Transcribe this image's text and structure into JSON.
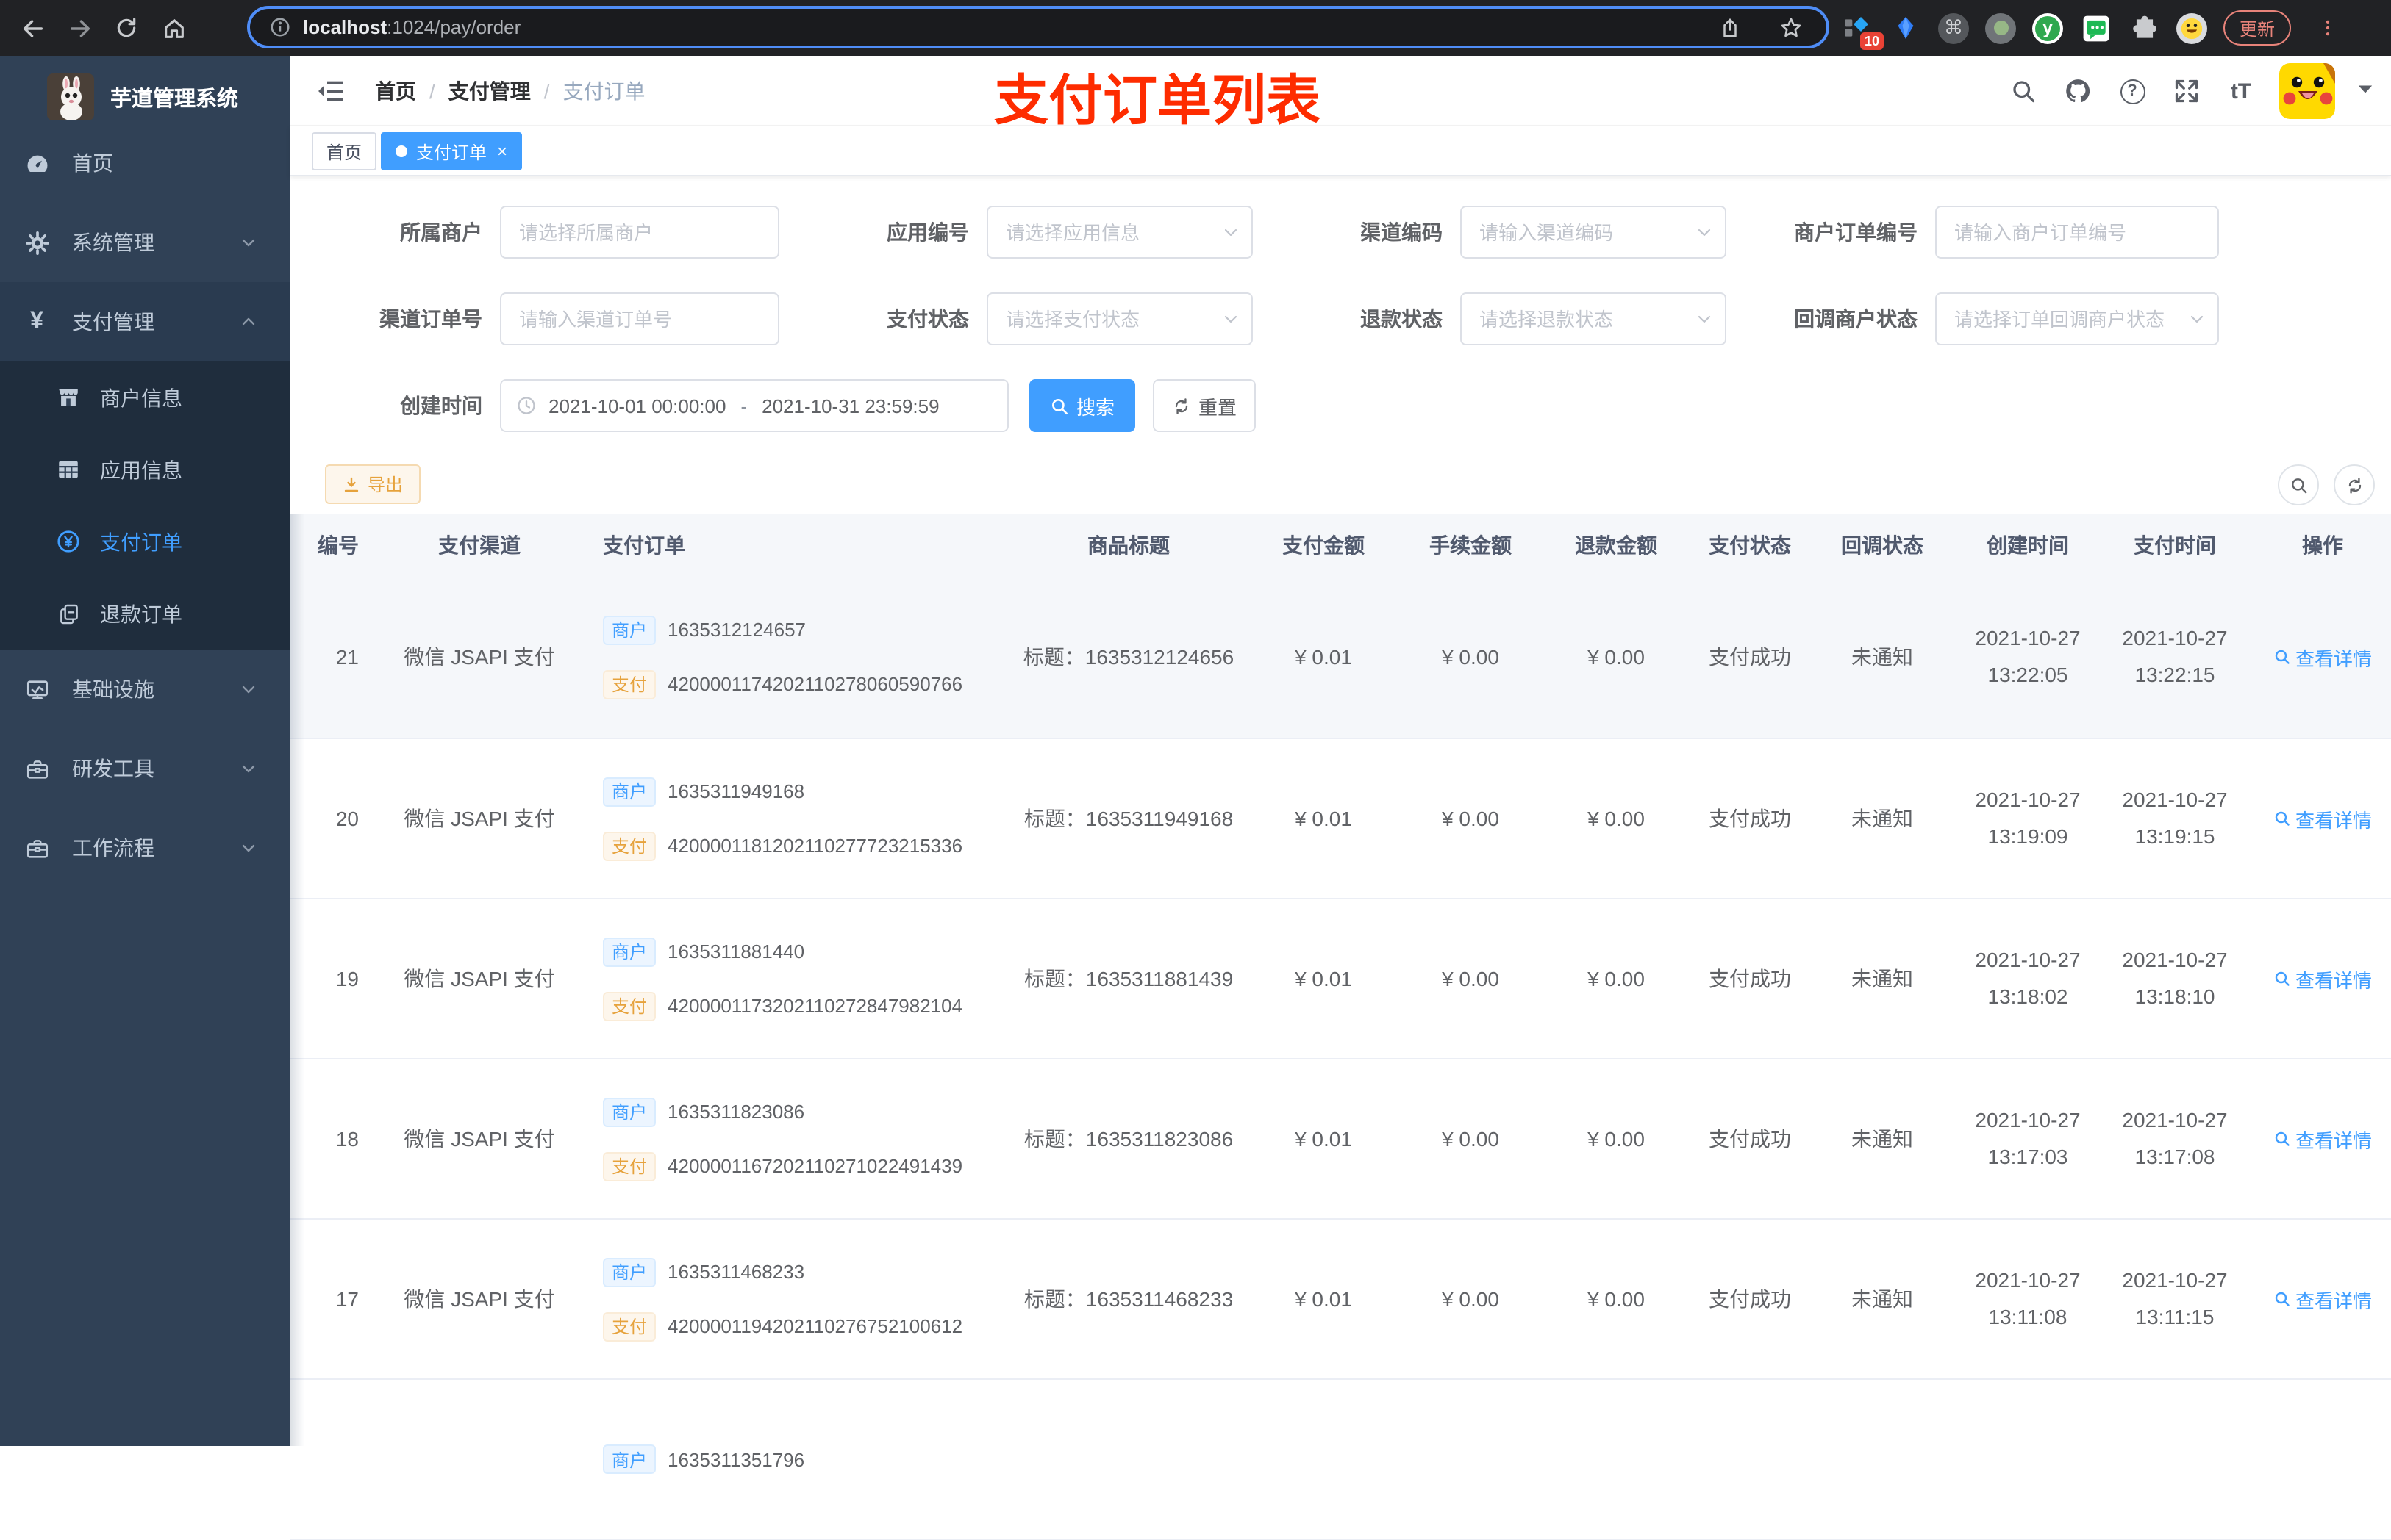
{
  "browser": {
    "url_host": "localhost",
    "url_rest": ":1024/pay/order",
    "ext_badge": "10",
    "ext_cmd": "⌘",
    "ext_y": "y",
    "update_label": "更新"
  },
  "sidebar": {
    "title": "芋道管理系统",
    "menu": [
      {
        "label": "首页"
      },
      {
        "label": "系统管理"
      },
      {
        "label": "支付管理"
      }
    ],
    "submenu": [
      {
        "label": "商户信息"
      },
      {
        "label": "应用信息"
      },
      {
        "label": "支付订单"
      },
      {
        "label": "退款订单"
      }
    ],
    "menu2": [
      {
        "label": "基础设施"
      },
      {
        "label": "研发工具"
      },
      {
        "label": "工作流程"
      }
    ]
  },
  "navbar": {
    "breadcrumb": [
      "首页",
      "支付管理",
      "支付订单"
    ],
    "sep": "/",
    "font_icon_label": "tT"
  },
  "overlay_title": "支付订单列表",
  "tags": {
    "home": "首页",
    "active": "支付订单",
    "close": "×"
  },
  "filters": {
    "f1": {
      "label": "所属商户",
      "placeholder": "请选择所属商户"
    },
    "f2": {
      "label": "应用编号",
      "placeholder": "请选择应用信息"
    },
    "f3": {
      "label": "渠道编码",
      "placeholder": "请输入渠道编码"
    },
    "f4": {
      "label": "商户订单编号",
      "placeholder": "请输入商户订单编号"
    },
    "f5": {
      "label": "渠道订单号",
      "placeholder": "请输入渠道订单号"
    },
    "f6": {
      "label": "支付状态",
      "placeholder": "请选择支付状态"
    },
    "f7": {
      "label": "退款状态",
      "placeholder": "请选择退款状态"
    },
    "f8": {
      "label": "回调商户状态",
      "placeholder": "请选择订单回调商户状态"
    },
    "f9": {
      "label": "创建时间",
      "start": "2021-10-01 00:00:00",
      "sep": "-",
      "end": "2021-10-31 23:59:59"
    }
  },
  "actions": {
    "search": "搜索",
    "reset": "重置",
    "export": "导出"
  },
  "table": {
    "columns": [
      "编号",
      "支付渠道",
      "支付订单",
      "商品标题",
      "支付金额",
      "手续金额",
      "退款金额",
      "支付状态",
      "回调状态",
      "创建时间",
      "支付时间",
      "操作"
    ],
    "tag_merchant": "商户",
    "tag_pay": "支付",
    "rows": [
      {
        "id": "21",
        "channel": "微信 JSAPI 支付",
        "merchant_no": "1635312124657",
        "pay_no": "4200001174202110278060590766",
        "title": "标题：1635312124656",
        "amount": "¥ 0.01",
        "fee": "¥ 0.00",
        "refund": "¥ 0.00",
        "status": "支付成功",
        "notify": "未通知",
        "created_date": "2021-10-27",
        "created_time": "13:22:05",
        "paid_date": "2021-10-27",
        "paid_time": "13:22:15",
        "action": "查看详情"
      },
      {
        "id": "20",
        "channel": "微信 JSAPI 支付",
        "merchant_no": "1635311949168",
        "pay_no": "4200001181202110277723215336",
        "title": "标题：1635311949168",
        "amount": "¥ 0.01",
        "fee": "¥ 0.00",
        "refund": "¥ 0.00",
        "status": "支付成功",
        "notify": "未通知",
        "created_date": "2021-10-27",
        "created_time": "13:19:09",
        "paid_date": "2021-10-27",
        "paid_time": "13:19:15",
        "action": "查看详情"
      },
      {
        "id": "19",
        "channel": "微信 JSAPI 支付",
        "merchant_no": "1635311881440",
        "pay_no": "4200001173202110272847982104",
        "title": "标题：1635311881439",
        "amount": "¥ 0.01",
        "fee": "¥ 0.00",
        "refund": "¥ 0.00",
        "status": "支付成功",
        "notify": "未通知",
        "created_date": "2021-10-27",
        "created_time": "13:18:02",
        "paid_date": "2021-10-27",
        "paid_time": "13:18:10",
        "action": "查看详情"
      },
      {
        "id": "18",
        "channel": "微信 JSAPI 支付",
        "merchant_no": "1635311823086",
        "pay_no": "4200001167202110271022491439",
        "title": "标题：1635311823086",
        "amount": "¥ 0.01",
        "fee": "¥ 0.00",
        "refund": "¥ 0.00",
        "status": "支付成功",
        "notify": "未通知",
        "created_date": "2021-10-27",
        "created_time": "13:17:03",
        "paid_date": "2021-10-27",
        "paid_time": "13:17:08",
        "action": "查看详情"
      },
      {
        "id": "17",
        "channel": "微信 JSAPI 支付",
        "merchant_no": "1635311468233",
        "pay_no": "4200001194202110276752100612",
        "title": "标题：1635311468233",
        "amount": "¥ 0.01",
        "fee": "¥ 0.00",
        "refund": "¥ 0.00",
        "status": "支付成功",
        "notify": "未通知",
        "created_date": "2021-10-27",
        "created_time": "13:11:08",
        "paid_date": "2021-10-27",
        "paid_time": "13:11:15",
        "action": "查看详情"
      },
      {
        "id": "",
        "channel": "",
        "merchant_no": "1635311351796",
        "pay_no": "",
        "title": "",
        "amount": "",
        "fee": "",
        "refund": "",
        "status": "",
        "notify": "",
        "created_date": "",
        "created_time": "",
        "paid_date": "",
        "paid_time": "",
        "action": ""
      }
    ]
  }
}
